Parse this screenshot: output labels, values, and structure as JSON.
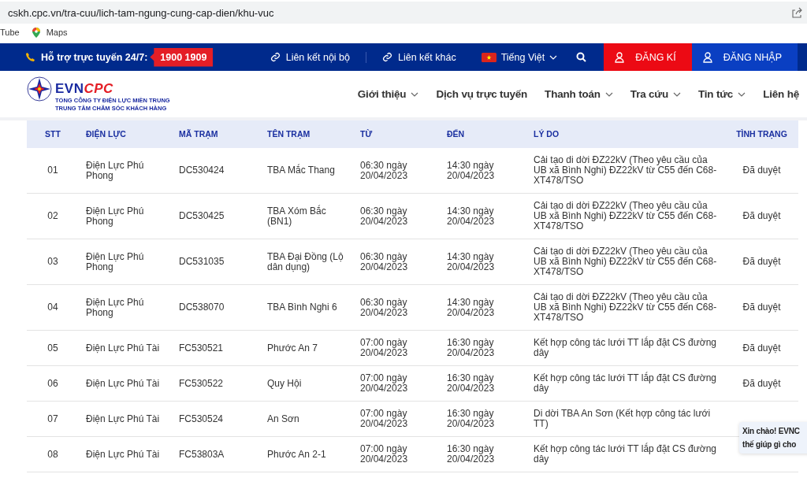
{
  "browser": {
    "url": "cskh.cpc.vn/tra-cuu/lich-tam-ngung-cung-cap-dien/khu-vuc",
    "bookmarks": [
      {
        "label": "Tube",
        "kind": "plain"
      },
      {
        "label": "Maps",
        "kind": "map"
      }
    ]
  },
  "topbar": {
    "support_label": "Hỗ trợ trực tuyến 24/7:",
    "hotline": "1900 1909",
    "links": [
      "Liên kết nội bộ",
      "Liên kết khác"
    ],
    "language": "Tiếng Việt",
    "buttons": [
      {
        "label": "ĐĂNG KÍ",
        "kind": "register"
      },
      {
        "label": "ĐĂNG NHẬP",
        "kind": "login"
      }
    ]
  },
  "header": {
    "brand_a": "EVN",
    "brand_b": "CPC",
    "subtitle_lines": [
      "TỔNG CÔNG TY ĐIỆN LỰC MIỀN TRUNG",
      "TRUNG TÂM CHĂM SÓC KHÁCH HÀNG"
    ],
    "nav": [
      {
        "label": "Giới thiệu",
        "has_menu": true
      },
      {
        "label": "Dịch vụ trực tuyến",
        "has_menu": false
      },
      {
        "label": "Thanh toán",
        "has_menu": true
      },
      {
        "label": "Tra cứu",
        "has_menu": true
      },
      {
        "label": "Tin tức",
        "has_menu": true
      },
      {
        "label": "Liên hệ",
        "has_menu": false
      }
    ]
  },
  "table": {
    "columns": [
      "STT",
      "ĐIỆN LỰC",
      "MÃ TRẠM",
      "TÊN TRẠM",
      "TỪ",
      "ĐẾN",
      "LÝ DO",
      "TÌNH TRẠNG"
    ],
    "rows": [
      {
        "cells": [
          "01",
          "Điện Lực Phú Phong",
          "DC530424",
          "TBA Mắc Thang",
          "06:30 ngày 20/04/2023",
          "14:30 ngày 20/04/2023",
          "Cải tạo di dời ĐZ22kV (Theo yêu cầu của UB xã Bình Nghi) ĐZ22kV từ C55 đến C68-XT478/TSO",
          "Đã duyệt"
        ]
      },
      {
        "cells": [
          "02",
          "Điện Lực Phú Phong",
          "DC530425",
          "TBA Xóm Bắc (BN1)",
          "06:30 ngày 20/04/2023",
          "14:30 ngày 20/04/2023",
          "Cải tạo di dời ĐZ22kV (Theo yêu cầu của UB xã Bình Nghi) ĐZ22kV từ C55 đến C68-XT478/TSO",
          "Đã duyệt"
        ]
      },
      {
        "cells": [
          "03",
          "Điện Lực Phú Phong",
          "DC531035",
          "TBA Đại Đồng (Lộ dân dụng)",
          "06:30 ngày 20/04/2023",
          "14:30 ngày 20/04/2023",
          "Cải tạo di dời ĐZ22kV (Theo yêu cầu của UB xã Bình Nghi) ĐZ22kV từ C55 đến C68-XT478/TSO",
          "Đã duyệt"
        ]
      },
      {
        "cells": [
          "04",
          "Điện Lực Phú Phong",
          "DC538070",
          "TBA Bình Nghi 6",
          "06:30 ngày 20/04/2023",
          "14:30 ngày 20/04/2023",
          "Cải tạo di dời ĐZ22kV (Theo yêu cầu của UB xã Bình Nghi) ĐZ22kV từ C55 đến C68-XT478/TSO",
          "Đã duyệt"
        ]
      },
      {
        "cells": [
          "05",
          "Điện Lực Phú Tài",
          "FC530521",
          "Phước An 7",
          "07:00 ngày 20/04/2023",
          "16:30 ngày 20/04/2023",
          "Kết hợp công tác lưới TT lắp đặt CS đường dây",
          "Đã duyệt"
        ]
      },
      {
        "cells": [
          "06",
          "Điện Lực Phú Tài",
          "FC530522",
          "Quy Hội",
          "07:00 ngày 20/04/2023",
          "16:30 ngày 20/04/2023",
          "Kết hợp công tác lưới TT lắp đặt CS đường dây",
          "Đã duyệt"
        ]
      },
      {
        "cells": [
          "07",
          "Điện Lực Phú Tài",
          "FC530524",
          "An Sơn",
          "07:00 ngày 20/04/2023",
          "16:30 ngày 20/04/2023",
          "Di dời TBA An Sơn (Kết hợp công tác lưới TT)"
        ]
      },
      {
        "cells": [
          "08",
          "Điện Lực Phú Tài",
          "FC53803A",
          "Phước An 2-1",
          "07:00 ngày 20/04/2023",
          "16:30 ngày 20/04/2023",
          "Kết hợp công tác lưới TT lắp đặt CS đường dây"
        ]
      }
    ]
  },
  "chat_popup": {
    "lines": [
      "Xin chào! EVNC",
      "thế giúp gì cho"
    ]
  }
}
